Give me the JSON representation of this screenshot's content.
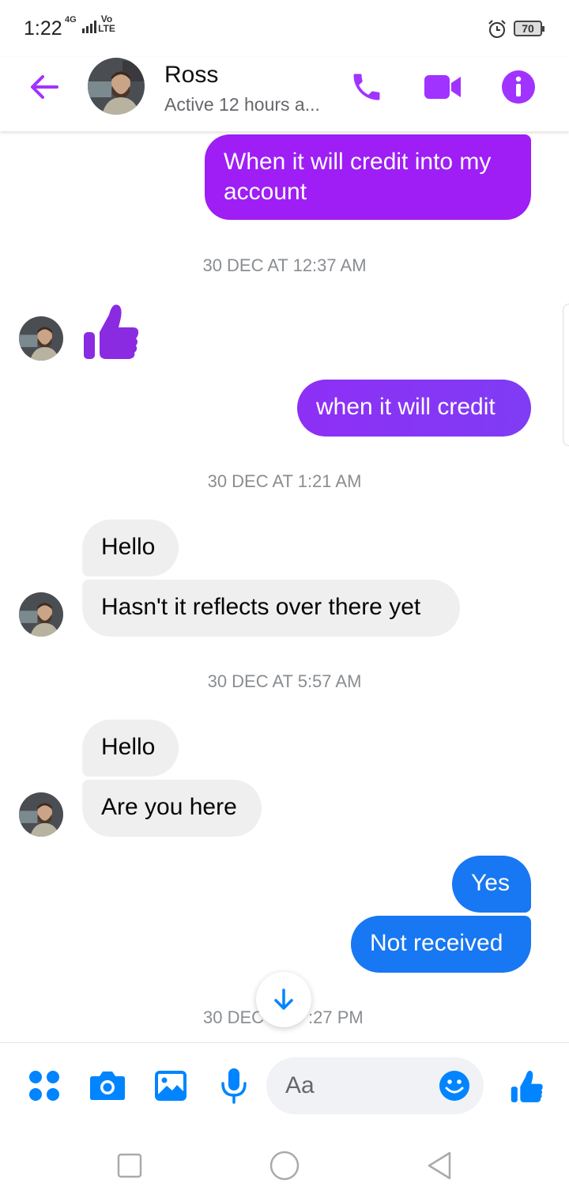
{
  "status_bar": {
    "time": "1:22",
    "network": "4G",
    "volte": "Vo LTE",
    "battery": "70"
  },
  "header": {
    "contact_name": "Ross",
    "contact_status": "Active 12 hours a...",
    "accent_color": "#a033ff"
  },
  "messages": {
    "m1": "When it will credit into my",
    "m1b": "account",
    "ts1": "30 DEC AT 12:37 AM",
    "m2": "when it will credit",
    "ts2": "30 DEC AT 1:21 AM",
    "m3": "Hello",
    "m4": "Hasn't it reflects over there yet",
    "ts3": "30 DEC AT 5:57 AM",
    "m5": "Hello",
    "m6": "Are you here",
    "m7": "Yes",
    "m8": "Not received",
    "ts4_left": "30 DEC",
    "ts4_right": ":27 PM"
  },
  "composer": {
    "placeholder": "Aa",
    "accent_color": "#0084ff"
  },
  "colors": {
    "purple_bubble": "#9e1ef5",
    "violet_bubble": "#8a35f2",
    "blue_bubble": "#1877f2",
    "incoming_bubble": "#efefef"
  }
}
